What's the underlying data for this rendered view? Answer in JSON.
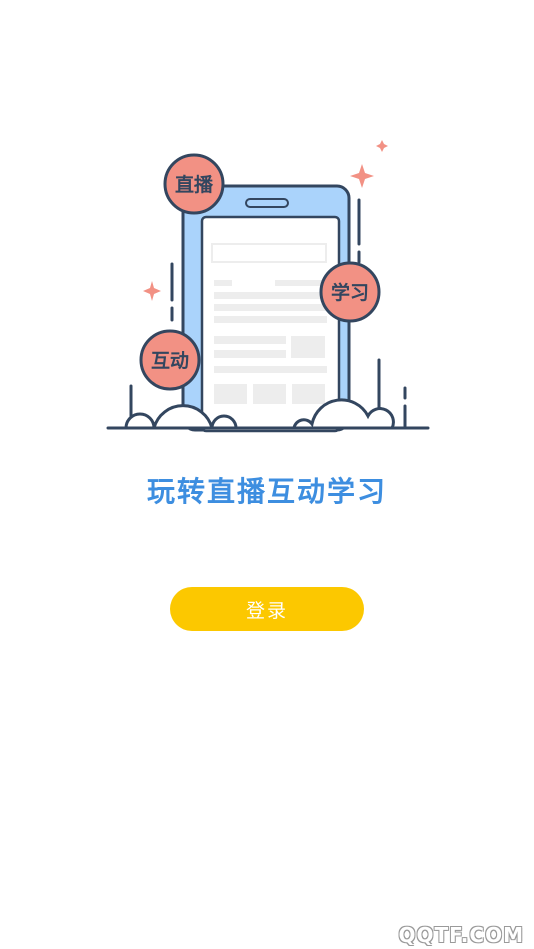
{
  "illustration": {
    "badges": [
      "直播",
      "学习",
      "互动"
    ],
    "colors": {
      "outline": "#33465f",
      "phone_body": "#aad3fb",
      "badge_fill": "#f29184",
      "sparkle": "#f29184",
      "screen_fill": "#ffffff",
      "placeholder_gray": "#ededed"
    }
  },
  "slogan": "玩转直播互动学习",
  "login_button": {
    "label": "登录",
    "color": "#fcc800"
  },
  "watermark": "QQTF.COM"
}
